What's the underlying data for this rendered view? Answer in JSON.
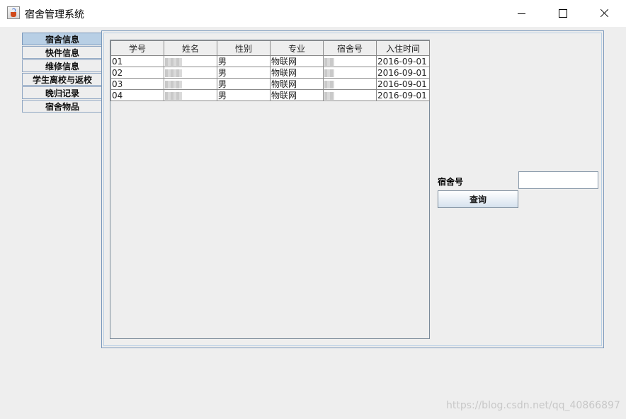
{
  "window": {
    "title": "宿舍管理系统"
  },
  "tabs": [
    {
      "label": "宿舍信息",
      "active": true
    },
    {
      "label": "快件信息",
      "active": false
    },
    {
      "label": "维修信息",
      "active": false
    },
    {
      "label": "学生离校与返校",
      "active": false
    },
    {
      "label": "晚归记录",
      "active": false
    },
    {
      "label": "宿舍物品",
      "active": false
    }
  ],
  "table": {
    "columns": [
      "学号",
      "姓名",
      "性别",
      "专业",
      "宿舍号",
      "入住时间"
    ],
    "rows": [
      [
        "01",
        "",
        "男",
        "物联网",
        "",
        "2016-09-01"
      ],
      [
        "02",
        "",
        "男",
        "物联网",
        "",
        "2016-09-01"
      ],
      [
        "03",
        "",
        "男",
        "物联网",
        "",
        "2016-09-01"
      ],
      [
        "04",
        "",
        "男",
        "物联网",
        "",
        "2016-09-01"
      ]
    ]
  },
  "search": {
    "label": "宿舍号",
    "value": "",
    "button_label": "查询"
  },
  "watermark": "https://blog.csdn.net/qq_40866897",
  "colors": {
    "tab_active": "#b8cfe5",
    "border": "#7a98bb"
  }
}
